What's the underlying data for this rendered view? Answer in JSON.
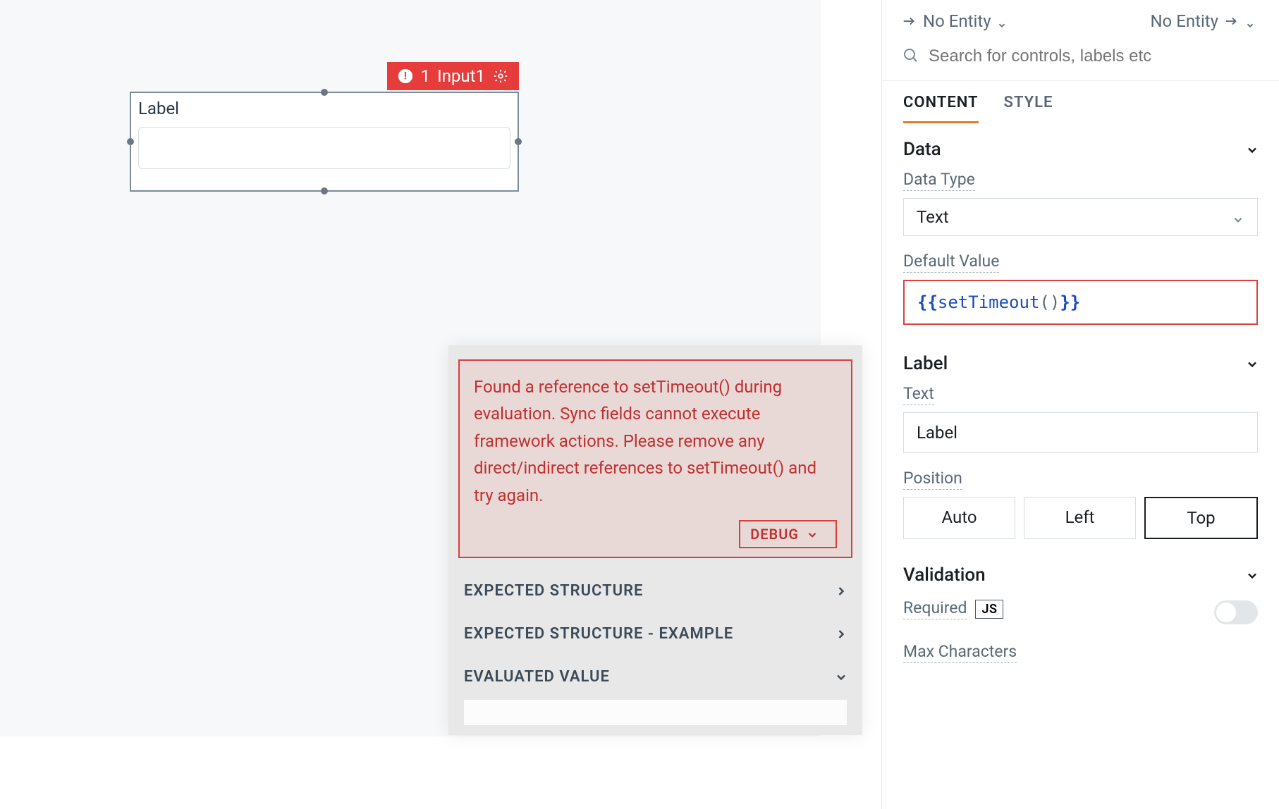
{
  "canvas": {
    "widget_label": "Label",
    "badge": {
      "error_count": "1",
      "name": "Input1"
    }
  },
  "popover": {
    "error_message": "Found a reference to setTimeout() during evaluation. Sync fields cannot execute framework actions. Please remove any direct/indirect references to setTimeout() and try again.",
    "debug_label": "DEBUG",
    "rows": {
      "expected_structure": "EXPECTED STRUCTURE",
      "expected_structure_example": "EXPECTED STRUCTURE - EXAMPLE",
      "evaluated_value": "EVALUATED VALUE"
    }
  },
  "panel": {
    "entity_in": "No Entity",
    "entity_out": "No Entity",
    "search_placeholder": "Search for controls, labels etc",
    "tabs": {
      "content": "CONTENT",
      "style": "STYLE"
    },
    "data": {
      "title": "Data",
      "data_type_label": "Data Type",
      "data_type_value": "Text",
      "default_value_label": "Default Value",
      "default_value_open": "{{",
      "default_value_fn": "setTimeout",
      "default_value_paren": "()",
      "default_value_close": "}}"
    },
    "label": {
      "title": "Label",
      "text_label": "Text",
      "text_value": "Label",
      "position_label": "Position",
      "options": {
        "auto": "Auto",
        "left": "Left",
        "top": "Top"
      }
    },
    "validation": {
      "title": "Validation",
      "required_label": "Required",
      "js_badge": "JS",
      "max_chars_label": "Max Characters"
    }
  }
}
